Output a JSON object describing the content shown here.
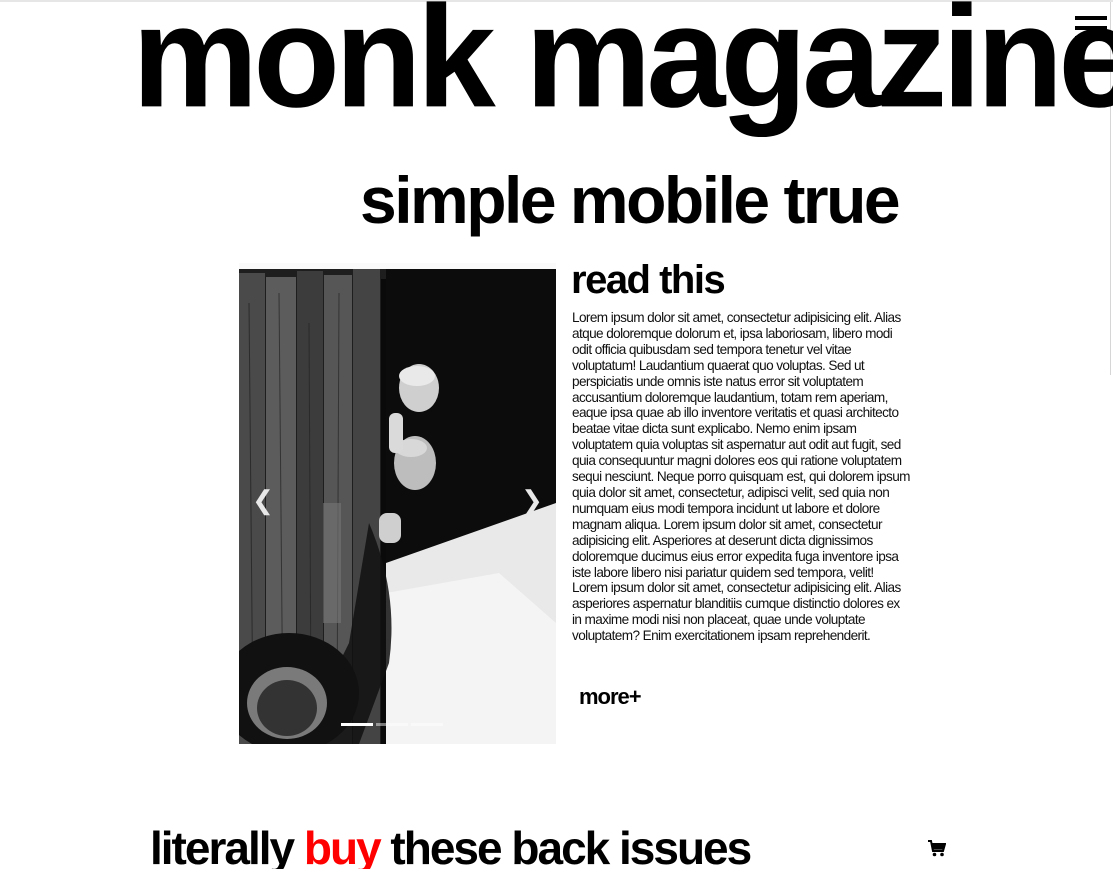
{
  "header": {
    "masthead": "monk magazine",
    "tagline": "simple mobile true",
    "menu_icon": "hamburger-menu-icon"
  },
  "carousel": {
    "image_alt": "Two men peeking around a weathered wooden barn door",
    "prev_icon": "chevron-left-icon",
    "next_icon": "chevron-right-icon",
    "slide_count": 3,
    "active_slide": 1
  },
  "article": {
    "title": "read this",
    "body": "Lorem ipsum dolor sit amet, consectetur adipisicing elit. Alias atque doloremque dolorum et, ipsa laboriosam, libero modi odit officia quibusdam sed tempora tenetur vel vitae voluptatum! Laudantium quaerat quo voluptas. Sed ut perspiciatis unde omnis iste natus error sit voluptatem accusantium doloremque laudantium, totam rem aperiam, eaque ipsa quae ab illo inventore veritatis et quasi architecto beatae vitae dicta sunt explicabo. Nemo enim ipsam voluptatem quia voluptas sit aspernatur aut odit aut fugit, sed quia consequuntur magni dolores eos qui ratione voluptatem sequi nesciunt. Neque porro quisquam est, qui dolorem ipsum quia dolor sit amet, consectetur, adipisci velit, sed quia non numquam eius modi tempora incidunt ut labore et dolore magnam aliqua. Lorem ipsum dolor sit amet, consectetur adipisicing elit. Asperiores at deserunt dicta dignissimos doloremque ducimus eius error expedita fuga inventore ipsa iste labore libero nisi pariatur quidem sed tempora, velit! Lorem ipsum dolor sit amet, consectetur adipisicing elit. Alias asperiores aspernatur blanditiis cumque distinctio dolores ex in maxime modi nisi non placeat, quae unde voluptate voluptatem? Enim exercitationem ipsam reprehenderit.",
    "more_label": "more+"
  },
  "back_issues": {
    "heading_part1": "literally ",
    "heading_accent": "buy",
    "heading_part2": " these back issues",
    "accent_color": "#ff0000",
    "cart_icon": "shopping-cart-icon"
  }
}
